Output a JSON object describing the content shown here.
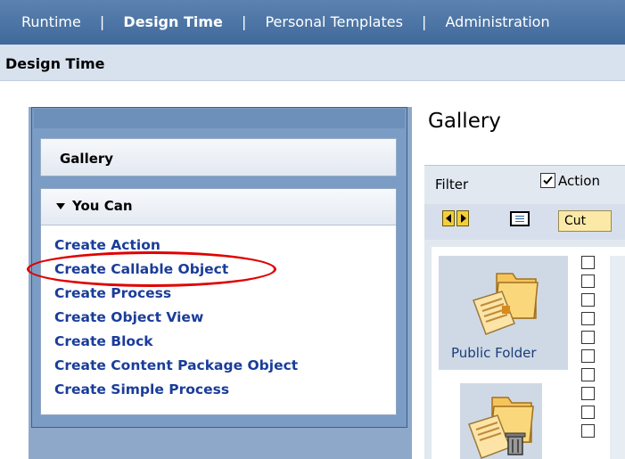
{
  "topnav": {
    "items": [
      {
        "label": "Runtime",
        "active": false
      },
      {
        "label": "Design Time",
        "active": true
      },
      {
        "label": "Personal Templates",
        "active": false
      },
      {
        "label": "Administration",
        "active": false
      }
    ],
    "separator": "|"
  },
  "subheader": {
    "title": "Design Time"
  },
  "sidebar": {
    "gallery_label": "Gallery",
    "youcan": {
      "title": "You Can",
      "actions": [
        "Create Action",
        "Create Callable Object",
        "Create Process",
        "Create Object View",
        "Create Block",
        "Create Content Package Object",
        "Create Simple Process"
      ],
      "highlighted_action": "Create Callable Object"
    }
  },
  "gallery": {
    "title": "Gallery",
    "filter": {
      "label": "Filter",
      "checkbox_label": "Action",
      "checkbox_checked": true
    },
    "toolbar": {
      "cut_label": "Cut"
    },
    "folders": [
      {
        "label": "Public Folder",
        "icon": "folder-icon"
      },
      {
        "label": "",
        "icon": "trash-folder-icon"
      }
    ]
  },
  "colors": {
    "nav_bg": "#4a72a3",
    "link": "#1a3d9a",
    "highlight": "#e00000",
    "panel_bg": "#7b9cc4"
  }
}
